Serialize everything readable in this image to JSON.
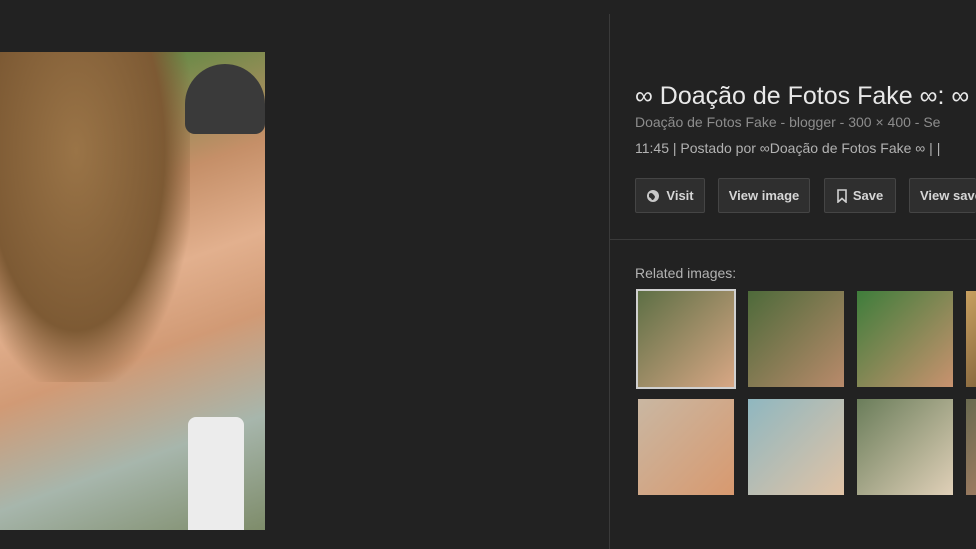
{
  "result": {
    "title": "∞ Doação de Fotos Fake ∞: ∞",
    "meta": "Doação de Fotos Fake - blogger - 300 × 400 - Se",
    "caption": "11:45 | Postado por ∞Doação de Fotos Fake ∞ | |"
  },
  "buttons": {
    "visit": "Visit",
    "view_image": "View image",
    "save": "Save",
    "view_saved": "View saved"
  },
  "related": {
    "label": "Related images:",
    "thumbnails": [
      {
        "name": "couple-hug-thumb",
        "colors": [
          "#5d6f45",
          "#d8a785"
        ]
      },
      {
        "name": "couple-pool-thumb",
        "colors": [
          "#4d6a3a",
          "#b98a6b"
        ]
      },
      {
        "name": "couple-grass-thumb",
        "colors": [
          "#3e7d3b",
          "#c9926f"
        ]
      },
      {
        "name": "partial-thumb-row1",
        "colors": [
          "#c8a060",
          "#8a6a40"
        ]
      },
      {
        "name": "selfie-thumb",
        "colors": [
          "#c9b7a2",
          "#d8996f"
        ]
      },
      {
        "name": "boat-thumb",
        "colors": [
          "#8fb7c0",
          "#e1c3a6"
        ]
      },
      {
        "name": "reading-thumb",
        "colors": [
          "#6a7d5a",
          "#e0d0b8"
        ]
      },
      {
        "name": "partial-thumb-row2",
        "colors": [
          "#6a6a50",
          "#9a7a60"
        ]
      }
    ]
  }
}
